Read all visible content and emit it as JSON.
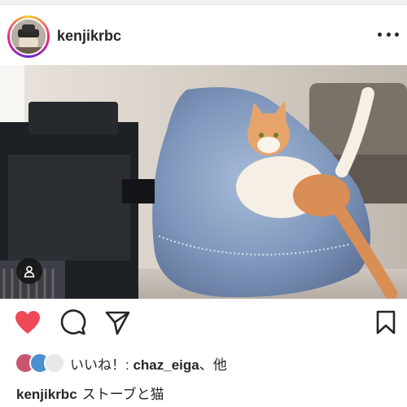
{
  "post": {
    "username": "kenjikrbc",
    "likes_prefix": "いいね！: ",
    "liked_by": "chaz_eiga",
    "likes_suffix": "、他",
    "caption_text": "ストーブと猫"
  },
  "icons": {
    "more": "more-options-icon",
    "like": "heart-filled-icon",
    "comment": "comment-bubble-icon",
    "share": "paper-plane-icon",
    "save": "bookmark-icon",
    "tag": "user-tag-icon"
  },
  "colors": {
    "like_red": "#ed4956",
    "text": "#262626"
  }
}
